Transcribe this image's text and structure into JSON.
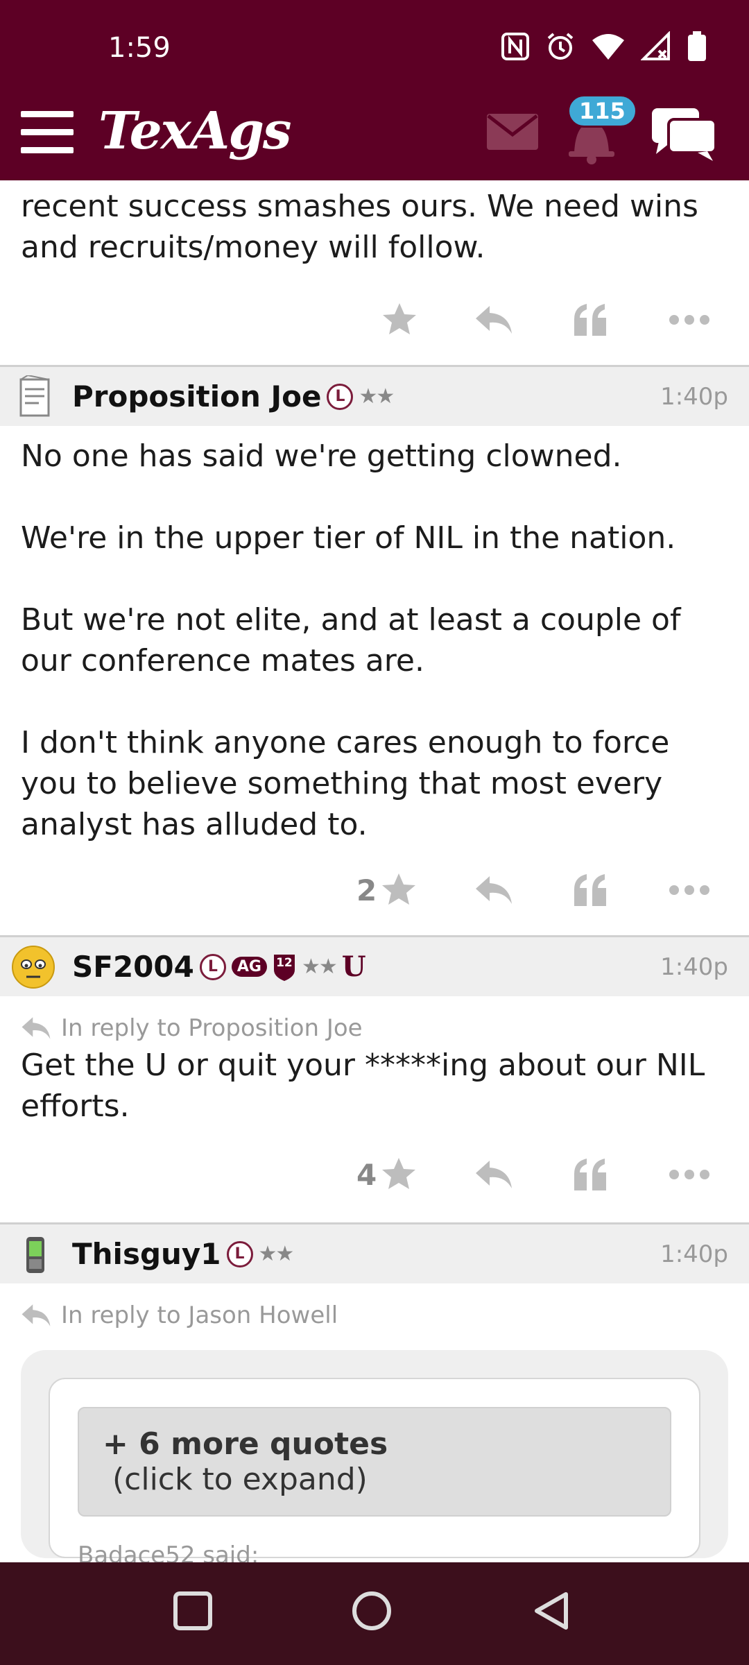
{
  "status": {
    "time": "1:59"
  },
  "header": {
    "logo": "TexAgs",
    "notifications_count": "115"
  },
  "top_post": {
    "text": "recent success smashes ours. We need wins and recruits/money will follow."
  },
  "posts": [
    {
      "username": "Proposition Joe",
      "badges": {
        "l": "L",
        "stars": "★★"
      },
      "time": "1:40p",
      "paragraphs": [
        "No one has said we're getting clowned.",
        "We're in the upper tier of NIL in the nation.",
        "But we're not elite, and at least a couple of our conference mates are.",
        "I don't think anyone cares enough to force you to believe something that most every analyst has alluded to."
      ],
      "star_count": "2"
    },
    {
      "username": "SF2004",
      "badges": {
        "l": "L",
        "ag": "AG",
        "shield": "12",
        "stars": "★★",
        "u": "U"
      },
      "time": "1:40p",
      "reply_to": "In reply to Proposition Joe",
      "text": "Get the U or quit your *****ing about our NIL efforts.",
      "star_count": "4"
    },
    {
      "username": "Thisguy1",
      "badges": {
        "l": "L",
        "stars": "★★"
      },
      "time": "1:40p",
      "reply_to": "In reply to Jason Howell",
      "expand_bold": "+ 6 more quotes",
      "expand_rest": " (click to expand)",
      "said": "Badace52 said:"
    }
  ],
  "colors": {
    "brand": "#5d0025",
    "badge": "#3fa9d6",
    "navbar": "#3c0f1c"
  },
  "icons": [
    "hamburger-icon",
    "mail-icon",
    "bell-icon",
    "chat-icon",
    "star-icon",
    "reply-icon",
    "quote-icon",
    "more-icon",
    "square-icon",
    "circle-icon",
    "triangle-icon"
  ]
}
